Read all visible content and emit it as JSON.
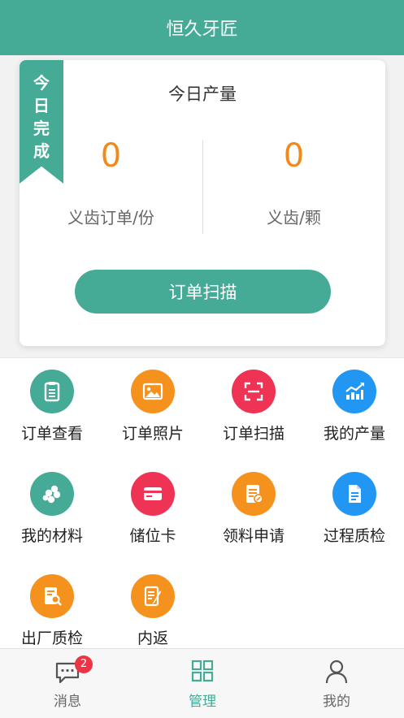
{
  "header": {
    "title": "恒久牙匠"
  },
  "today_card": {
    "ribbon": "今日完成",
    "title": "今日产量",
    "left_stat": {
      "value": "0",
      "label": "义齿订单/份"
    },
    "right_stat": {
      "value": "0",
      "label": "义齿/颗"
    },
    "scan_button_label": "订单扫描"
  },
  "menu": [
    {
      "label": "订单查看",
      "icon": "clipboard-icon",
      "color": "#45aa96"
    },
    {
      "label": "订单照片",
      "icon": "photo-icon",
      "color": "#f5921e"
    },
    {
      "label": "订单扫描",
      "icon": "scan-frame-icon",
      "color": "#ee3355"
    },
    {
      "label": "我的产量",
      "icon": "trend-chart-icon",
      "color": "#2196f3"
    },
    {
      "label": "我的材料",
      "icon": "materials-icon",
      "color": "#45aa96"
    },
    {
      "label": "储位卡",
      "icon": "card-icon",
      "color": "#ee3355"
    },
    {
      "label": "领料申请",
      "icon": "request-form-icon",
      "color": "#f5921e"
    },
    {
      "label": "过程质检",
      "icon": "document-icon",
      "color": "#2196f3"
    },
    {
      "label": "出厂质检",
      "icon": "inspect-doc-icon",
      "color": "#f5921e"
    },
    {
      "label": "内返",
      "icon": "return-doc-icon",
      "color": "#f5921e"
    }
  ],
  "tabbar": {
    "tabs": [
      {
        "label": "消息",
        "icon": "message-icon",
        "badge": "2"
      },
      {
        "label": "管理",
        "icon": "grid-icon",
        "active": true
      },
      {
        "label": "我的",
        "icon": "user-icon"
      }
    ]
  },
  "colors": {
    "primary": "#45aa96",
    "accent_orange": "#f08a1c",
    "badge_red": "#ee3344"
  }
}
